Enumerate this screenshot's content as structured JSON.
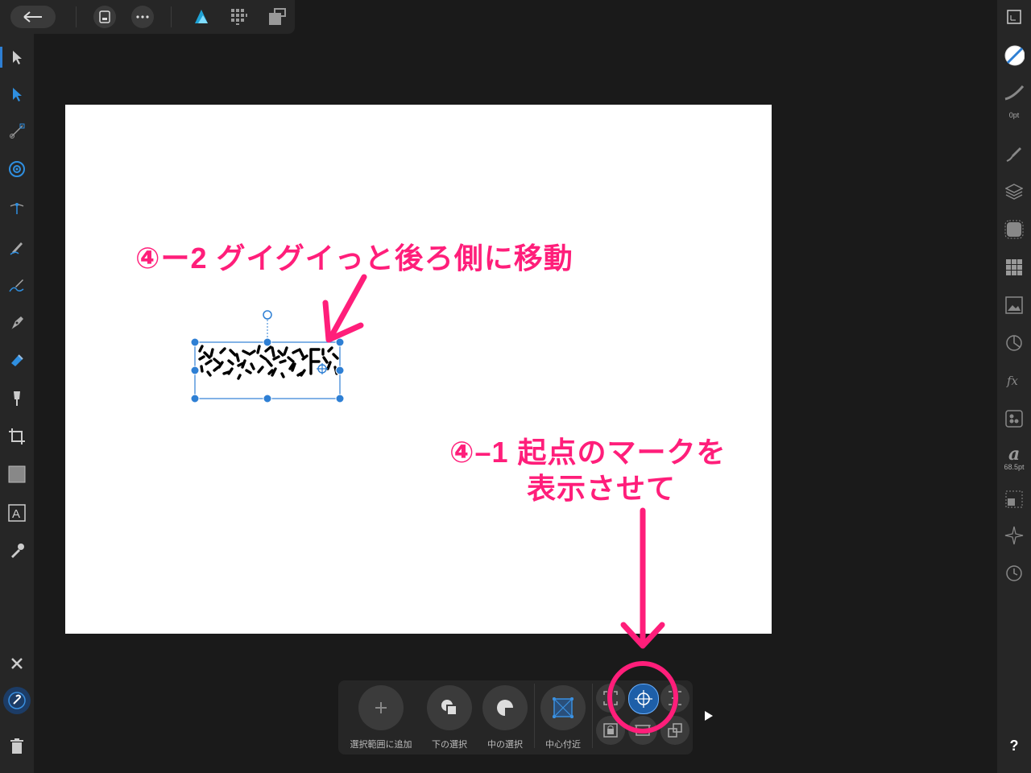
{
  "toolbar_top": {
    "icons": [
      "back-arrow-icon",
      "document-icon",
      "more-icon",
      "designer-persona-icon",
      "pixel-persona-icon",
      "export-persona-icon"
    ]
  },
  "left_tools": [
    "move-tool-icon",
    "node-tool-icon",
    "corner-tool-icon",
    "point-transform-tool-icon",
    "contour-tool-icon",
    "pencil-tool-icon",
    "vector-brush-tool-icon",
    "pen-tool-icon",
    "fill-tool-icon",
    "transparency-tool-icon",
    "crop-tool-icon",
    "rectangle-tool-icon",
    "artistic-text-tool-icon",
    "color-picker-tool-icon"
  ],
  "left_bottom": [
    "close-icon",
    "snapping-magnet-icon",
    "trash-icon"
  ],
  "right_panel": {
    "stroke_width": "0pt",
    "font_size": "68.5pt",
    "help": "?",
    "icons": [
      "navigator-icon",
      "color-icon",
      "stroke-icon",
      "brushes-icon",
      "layers-icon",
      "effects-icon",
      "swatches-icon",
      "image-icon",
      "transform-icon",
      "fx-icon",
      "symbols-icon",
      "text-styles-icon",
      "constraints-icon",
      "anchor-icon",
      "history-icon"
    ]
  },
  "context_bar": {
    "buttons": [
      {
        "label": "選択範囲に追加",
        "icon": "plus-icon"
      },
      {
        "label": "下の選択",
        "icon": "select-under-icon"
      },
      {
        "label": "中の選択",
        "icon": "select-inside-icon"
      },
      {
        "label": "中心付近",
        "icon": "transform-center-icon"
      }
    ],
    "small_buttons": [
      "bounding-box-icon",
      "transform-origin-icon",
      "geometry-icon",
      "lock-children-icon",
      "alignment-handles-icon",
      "transform-objects-icon"
    ],
    "expand_icon": "play-triangle-icon"
  },
  "annotations": {
    "step2": "④ー2  グイグイっと後ろ側に移動",
    "step1_line1": "④–1  起点のマークを",
    "step1_line2": "表示させて"
  },
  "colors": {
    "accent": "#ff1e7a",
    "selection": "#2e7fd4",
    "ui_bg": "#1a1a1a",
    "panel_bg": "#262626"
  }
}
